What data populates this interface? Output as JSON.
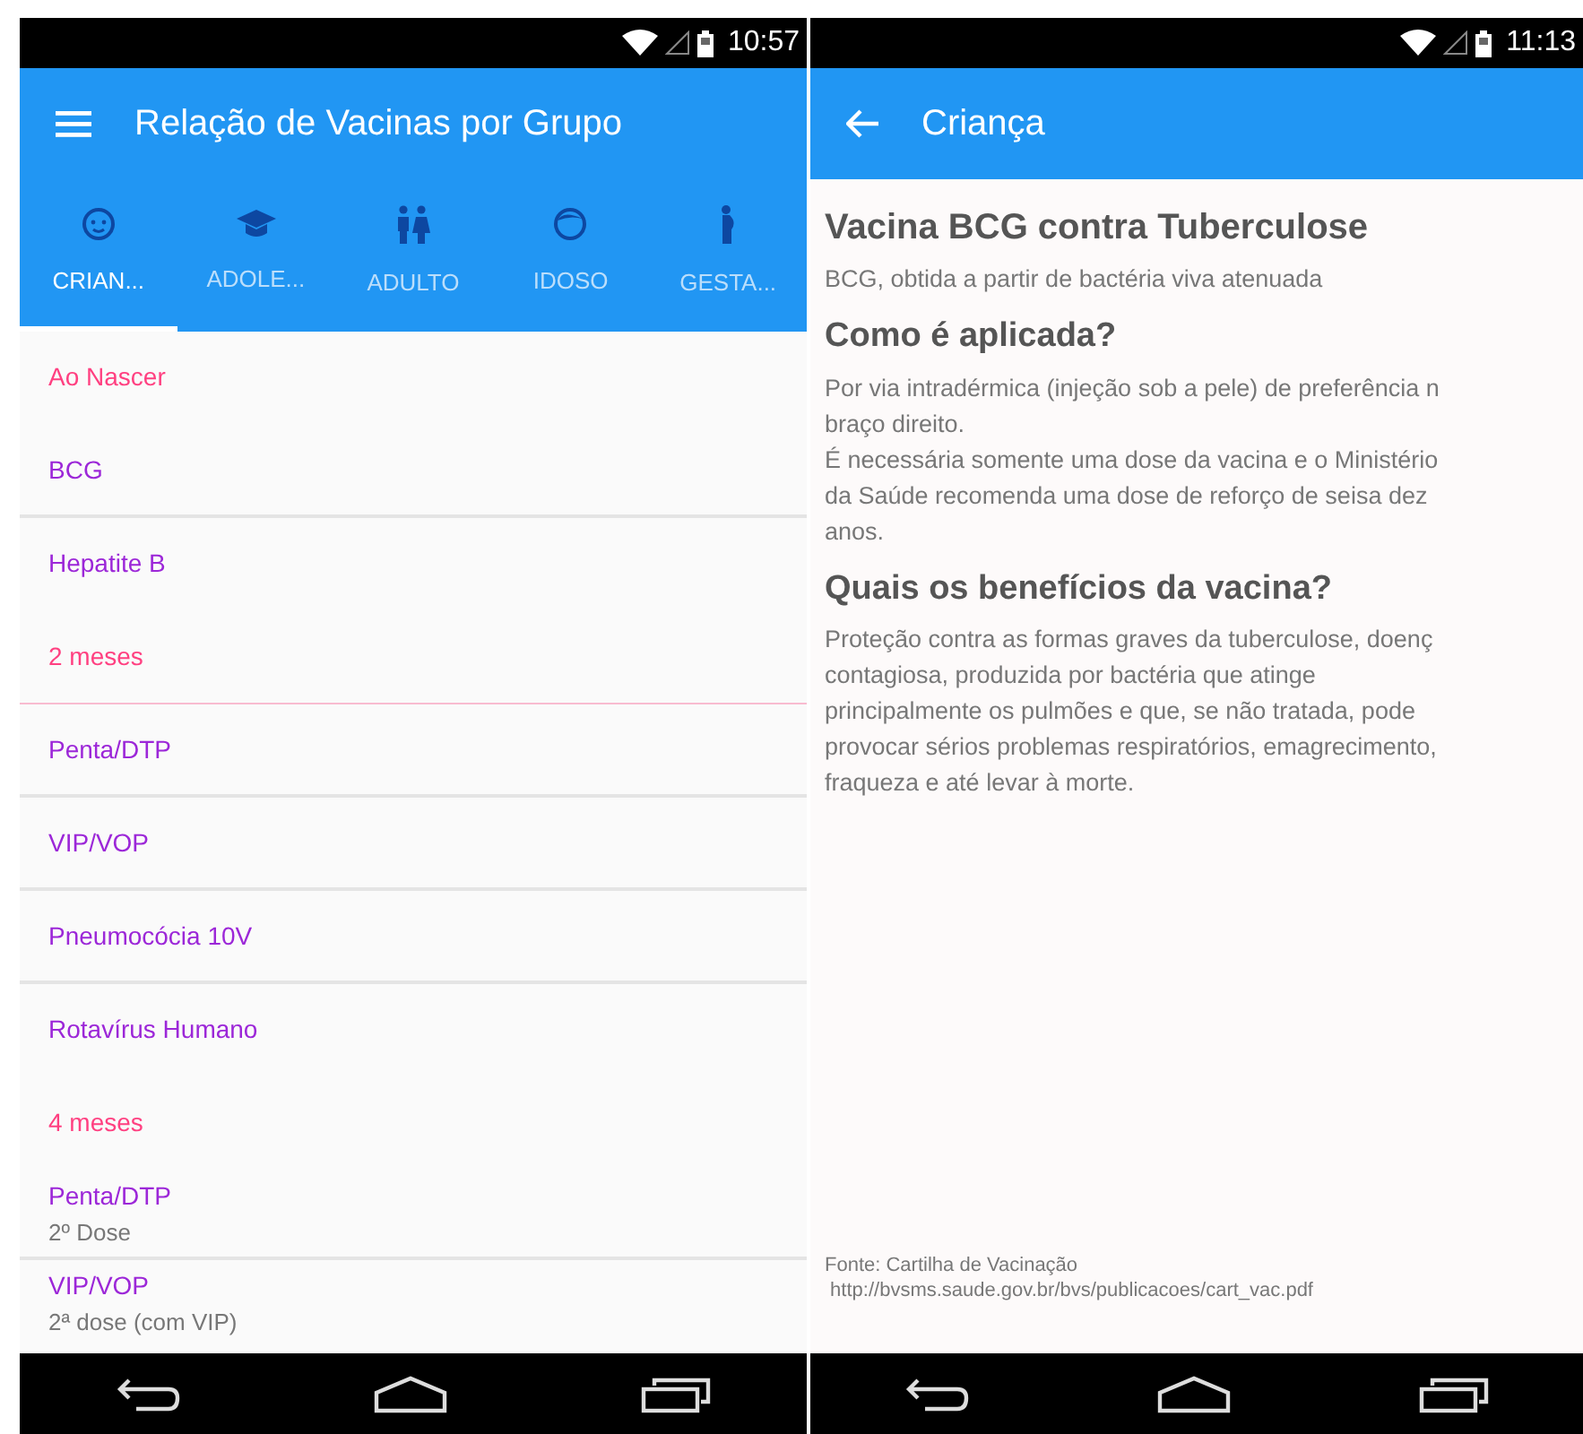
{
  "left_screen": {
    "status_bar": {
      "time": "10:57"
    },
    "app_bar": {
      "title": "Relação de Vacinas por Grupo"
    },
    "tabs": [
      {
        "label": "CRIAN...",
        "kind": "baby",
        "selected": true
      },
      {
        "label": "ADOLE...",
        "kind": "cap",
        "selected": false
      },
      {
        "label": "ADULTO",
        "kind": "couple",
        "selected": false
      },
      {
        "label": "IDOSO",
        "kind": "face",
        "selected": false
      },
      {
        "label": "GESTA...",
        "kind": "pregnant",
        "selected": false
      }
    ],
    "list": [
      {
        "kind": "header",
        "title": "Ao Nascer",
        "divider": false
      },
      {
        "kind": "vaccine",
        "title": "BCG",
        "divider": true
      },
      {
        "kind": "vaccine",
        "title": "Hepatite B",
        "divider": false
      },
      {
        "kind": "header",
        "title": "2 meses",
        "divider": true
      },
      {
        "kind": "vaccine",
        "title": "Penta/DTP",
        "divider": true
      },
      {
        "kind": "vaccine",
        "title": "VIP/VOP",
        "divider": true
      },
      {
        "kind": "vaccine",
        "title": "Pneumocócia 10V",
        "divider": true
      },
      {
        "kind": "vaccine",
        "title": "Rotavírus Humano",
        "divider": false
      },
      {
        "kind": "header",
        "title": "4 meses",
        "divider": false
      },
      {
        "kind": "vaccine",
        "title": "Penta/DTP",
        "subtitle": "2º Dose",
        "divider": true
      },
      {
        "kind": "vaccine",
        "title": "VIP/VOP",
        "subtitle": "2ª dose (com VIP)",
        "divider": false
      }
    ]
  },
  "right_screen": {
    "status_bar": {
      "time": "11:13"
    },
    "app_bar": {
      "title": "Criança"
    },
    "article": [
      {
        "kind": "title",
        "lines": [
          "Vacina BCG contra Tuberculose"
        ]
      },
      {
        "kind": "text",
        "lines": [
          "BCG, obtida a partir de bactéria viva atenuada"
        ]
      },
      {
        "kind": "heading",
        "lines": [
          "Como é aplicada?"
        ]
      },
      {
        "kind": "text",
        "lines": [
          "Por via intradérmica (injeção sob a pele) de preferência n",
          "braço direito.",
          "É necessária somente uma dose da vacina e o Ministério",
          "da Saúde recomenda uma dose de reforço de seisa dez",
          "anos."
        ]
      },
      {
        "kind": "heading",
        "lines": [
          "Quais os benefícios da vacina?"
        ]
      },
      {
        "kind": "text",
        "lines": [
          "Proteção contra as formas graves da tuberculose, doenç",
          "contagiosa, produzida por bactéria que atinge",
          "principalmente os pulmões e que, se não tratada, pode",
          "provocar sérios problemas respiratórios, emagrecimento,",
          "fraqueza e até levar à morte."
        ]
      }
    ],
    "source": {
      "lines": [
        "Fonte: Cartilha de Vacinação",
        " http://bvsms.saude.gov.br/bvs/publicacoes/cart_vac.pdf"
      ]
    }
  }
}
